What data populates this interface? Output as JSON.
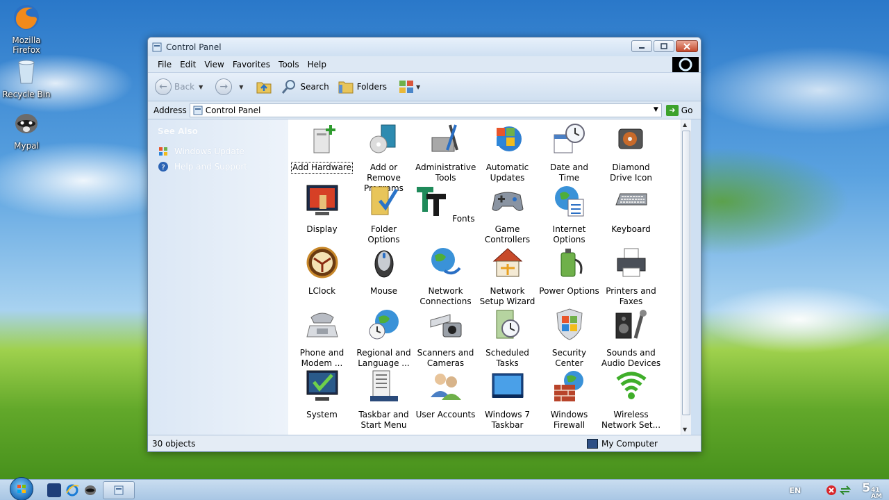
{
  "desktop": {
    "icons": [
      {
        "label": "Mozilla Firefox",
        "icon": "firefox-icon"
      },
      {
        "label": "Recycle Bin",
        "icon": "recycle-bin-icon"
      },
      {
        "label": "Mypal",
        "icon": "mypal-icon"
      }
    ]
  },
  "window": {
    "title": "Control Panel",
    "menu": [
      "File",
      "Edit",
      "View",
      "Favorites",
      "Tools",
      "Help"
    ],
    "toolbar": {
      "back_label": "Back",
      "search_label": "Search",
      "folders_label": "Folders"
    },
    "address": {
      "label": "Address",
      "value": "Control Panel",
      "go_label": "Go"
    },
    "sidebar": {
      "title": "See Also",
      "links": [
        "Windows Update",
        "Help and Support"
      ]
    },
    "items": [
      "Add Hardware",
      "Add or Remove Programs",
      "Administrative Tools",
      "Automatic Updates",
      "Date and Time",
      "Diamond Drive Icon",
      "Display",
      "Folder Options",
      "Fonts",
      "Game Controllers",
      "Internet Options",
      "Keyboard",
      "LClock",
      "Mouse",
      "Network Connections",
      "Network Setup Wizard",
      "Power Options",
      "Printers and Faxes",
      "Phone and Modem ...",
      "Regional and Language ...",
      "Scanners and Cameras",
      "Scheduled Tasks",
      "Security Center",
      "Sounds and Audio Devices",
      "System",
      "Taskbar and Start Menu",
      "User Accounts",
      "Windows 7 Taskbar",
      "Windows Firewall",
      "Wireless Network Set..."
    ],
    "status": {
      "count": "30 objects",
      "location": "My Computer"
    }
  },
  "taskbar": {
    "language": "EN",
    "clock_hour": "5",
    "clock_minute": "41",
    "clock_ampm": "AM"
  },
  "colors": {
    "accent": "#2a78c9",
    "window_bg": "#cfe0f2",
    "close_button": "#c54a2c"
  }
}
